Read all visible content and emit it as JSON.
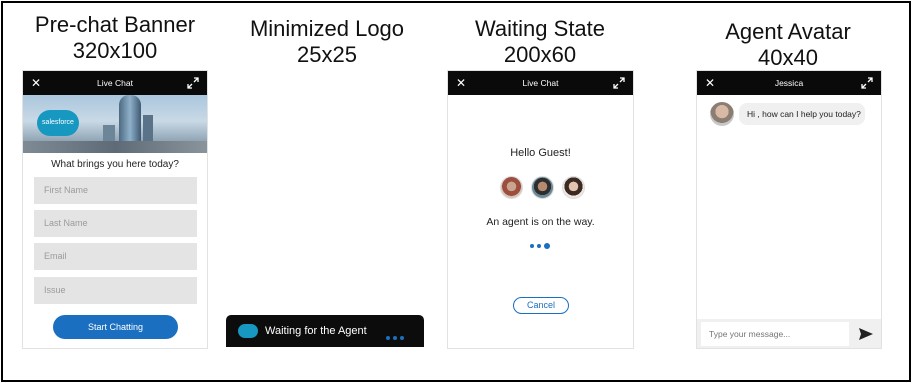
{
  "sections": {
    "prechat": {
      "title": "Pre-chat Banner",
      "size": "320x100"
    },
    "minimized": {
      "title": "Minimized Logo",
      "size": "25x25"
    },
    "waiting": {
      "title": "Waiting State",
      "size": "200x60"
    },
    "avatar": {
      "title": "Agent Avatar",
      "size": "40x40"
    }
  },
  "prechat_window": {
    "header_title": "Live Chat",
    "close_icon": "close-icon",
    "expand_icon": "expand-icon",
    "logo_text": "salesforce",
    "question": "What brings you here today?",
    "fields": [
      {
        "placeholder": "First Name"
      },
      {
        "placeholder": "Last Name"
      },
      {
        "placeholder": "Email"
      },
      {
        "placeholder": "Issue"
      }
    ],
    "submit_label": "Start Chatting"
  },
  "minimized_bar": {
    "label": "Waiting for the Agent",
    "logo_icon": "salesforce-cloud-icon"
  },
  "waiting_window": {
    "header_title": "Live Chat",
    "greeting": "Hello Guest!",
    "status": "An agent is on the way.",
    "cancel_label": "Cancel"
  },
  "agent_window": {
    "header_title": "Jessica",
    "message": "Hi , how can I help you today?",
    "input_placeholder": "Type your message...",
    "send_icon": "send-icon"
  },
  "colors": {
    "header_bg": "#0a0a0a",
    "accent": "#1a6fc0",
    "field_bg": "#e4e4e4",
    "brand": "#1798c1"
  }
}
